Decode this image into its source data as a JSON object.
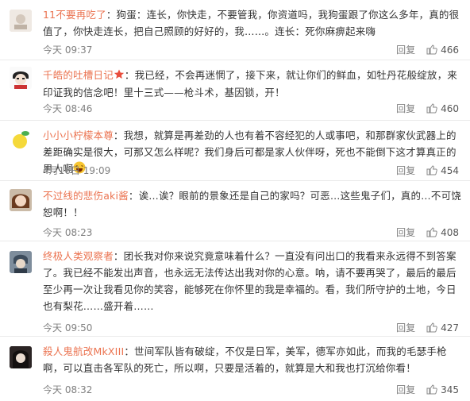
{
  "comments": [
    {
      "name": "11不要再吃了",
      "text": "：狗蛋：连长，你快走，不要管我，你资道吗，我狗蛋跟了你这么多年，真的很值了，你快走连长，把自己照顾的好好的，我……。连长：死你麻痹起来嗨",
      "time": "今天 09:37",
      "reply": "回复",
      "likes": "466"
    },
    {
      "name": "千皓的吐槽日记",
      "text": "：我已经，不会再迷惘了，接下来，就让你们的鲜血，如牡丹花般绽放，来印证我的信念吧！里十三式——枪斗术，基因锁，开！",
      "time": "今天 08:46",
      "reply": "回复",
      "likes": "460"
    },
    {
      "name": "小小小柠檬本尊",
      "text": "：我想，就算是再差劲的人也有着不容经犯的人或事吧，和那群家伙武器上的差距确实是很大，可那又怎么样呢？我们身后可都是家人伙伴呀，死也不能倒下这才算真正的男人啊",
      "time": "4月16日 19:09",
      "reply": "回复",
      "likes": "454"
    },
    {
      "name": "不过线的悲伤aki酱",
      "text": "：诶…诶？眼前的景象还是自己的家吗？可恶…这些鬼子们，真的…不可饶恕啊！！",
      "time": "今天 08:23",
      "reply": "回复",
      "likes": "408"
    },
    {
      "name": "终极人类观察者",
      "text": "：团长我对你来说究竟意味着什么？一直没有问出口的我看来永远得不到答案了。我已经不能发出声音，也永远无法传达出我对你的心意。呐，请不要再哭了，最后的最后至少再一次让我看见你的笑容，能够死在你怀里的我是幸福的。看，我们所守护的土地，今日也有梨花……盛开着……",
      "time": "今天 09:50",
      "reply": "回复",
      "likes": "427"
    },
    {
      "name": "殺人鬼航改MkXIII",
      "text": "：世间军队皆有破绽，不仅是日军，美军，德军亦如此，而我的毛瑟手枪啊，可以直击各军队的死亡，所以啊，只要是活着的，就算是大和我也打沉给你看！",
      "time": "今天 08:32",
      "reply": "回复",
      "likes": "345"
    }
  ]
}
